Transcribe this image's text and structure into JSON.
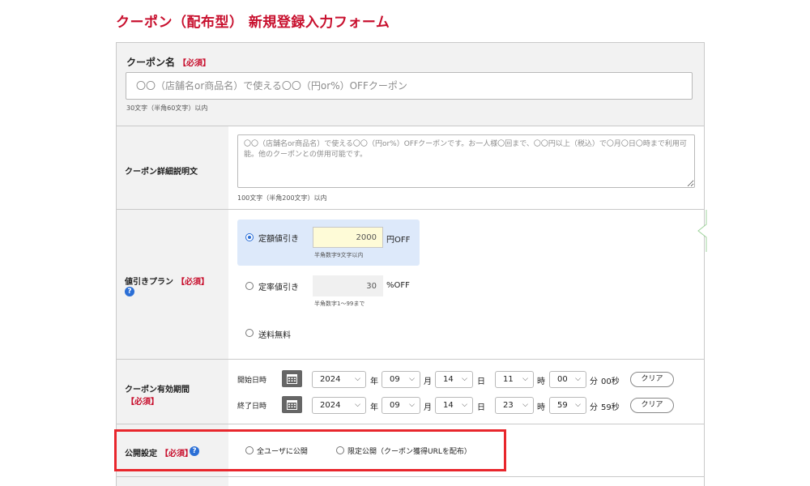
{
  "page": {
    "title": "クーポン（配布型） 新規登録入力フォーム"
  },
  "required_tag": "【必須】",
  "coupon_name": {
    "label": "クーポン名",
    "placeholder": "〇〇（店舗名or商品名）で使える〇〇（円or%）OFFクーポン",
    "value": "",
    "hint": "30文字（半角60文字）以内"
  },
  "description": {
    "label": "クーポン詳細説明文",
    "placeholder": "〇〇（店舗名or商品名）で使える〇〇（円or%）OFFクーポンです。お一人様〇回まで、〇〇円以上（税込）で〇月〇日〇時まで利用可能。他のクーポンとの併用可能です。",
    "hint": "100文字（半角200文字）以内"
  },
  "discount_plan": {
    "label": "値引きプラン",
    "help_icon": "question-circle-icon",
    "selected": "fixed",
    "options": {
      "fixed": {
        "label": "定額値引き",
        "value": "2000",
        "unit": "円OFF",
        "hint": "半角数字9文字以内"
      },
      "rate": {
        "label": "定率値引き",
        "value": "30",
        "unit": "%OFF",
        "hint": "半角数字1〜99まで"
      },
      "free_shipping": {
        "label": "送料無料"
      }
    }
  },
  "period": {
    "label": "クーポン有効期間",
    "year_unit": "年",
    "month_unit": "月",
    "day_unit": "日",
    "hour_unit": "時",
    "minute_unit": "分",
    "clear_label": "クリア",
    "calendar_icon": "calendar-icon",
    "start": {
      "label": "開始日時",
      "year": "2024",
      "month": "09",
      "day": "14",
      "hour": "11",
      "minute": "00",
      "seconds": "00秒"
    },
    "end": {
      "label": "終了日時",
      "year": "2024",
      "month": "09",
      "day": "14",
      "hour": "23",
      "minute": "59",
      "seconds": "59秒"
    }
  },
  "publish": {
    "label": "公開設定",
    "help_icon": "question-circle-icon",
    "options": [
      "全ユーザに公開",
      "限定公開（クーポン獲得URLを配布）"
    ]
  },
  "colors": {
    "title": "#c8102e",
    "highlight_box": "#e8262c",
    "accent": "#2b6fd6"
  }
}
